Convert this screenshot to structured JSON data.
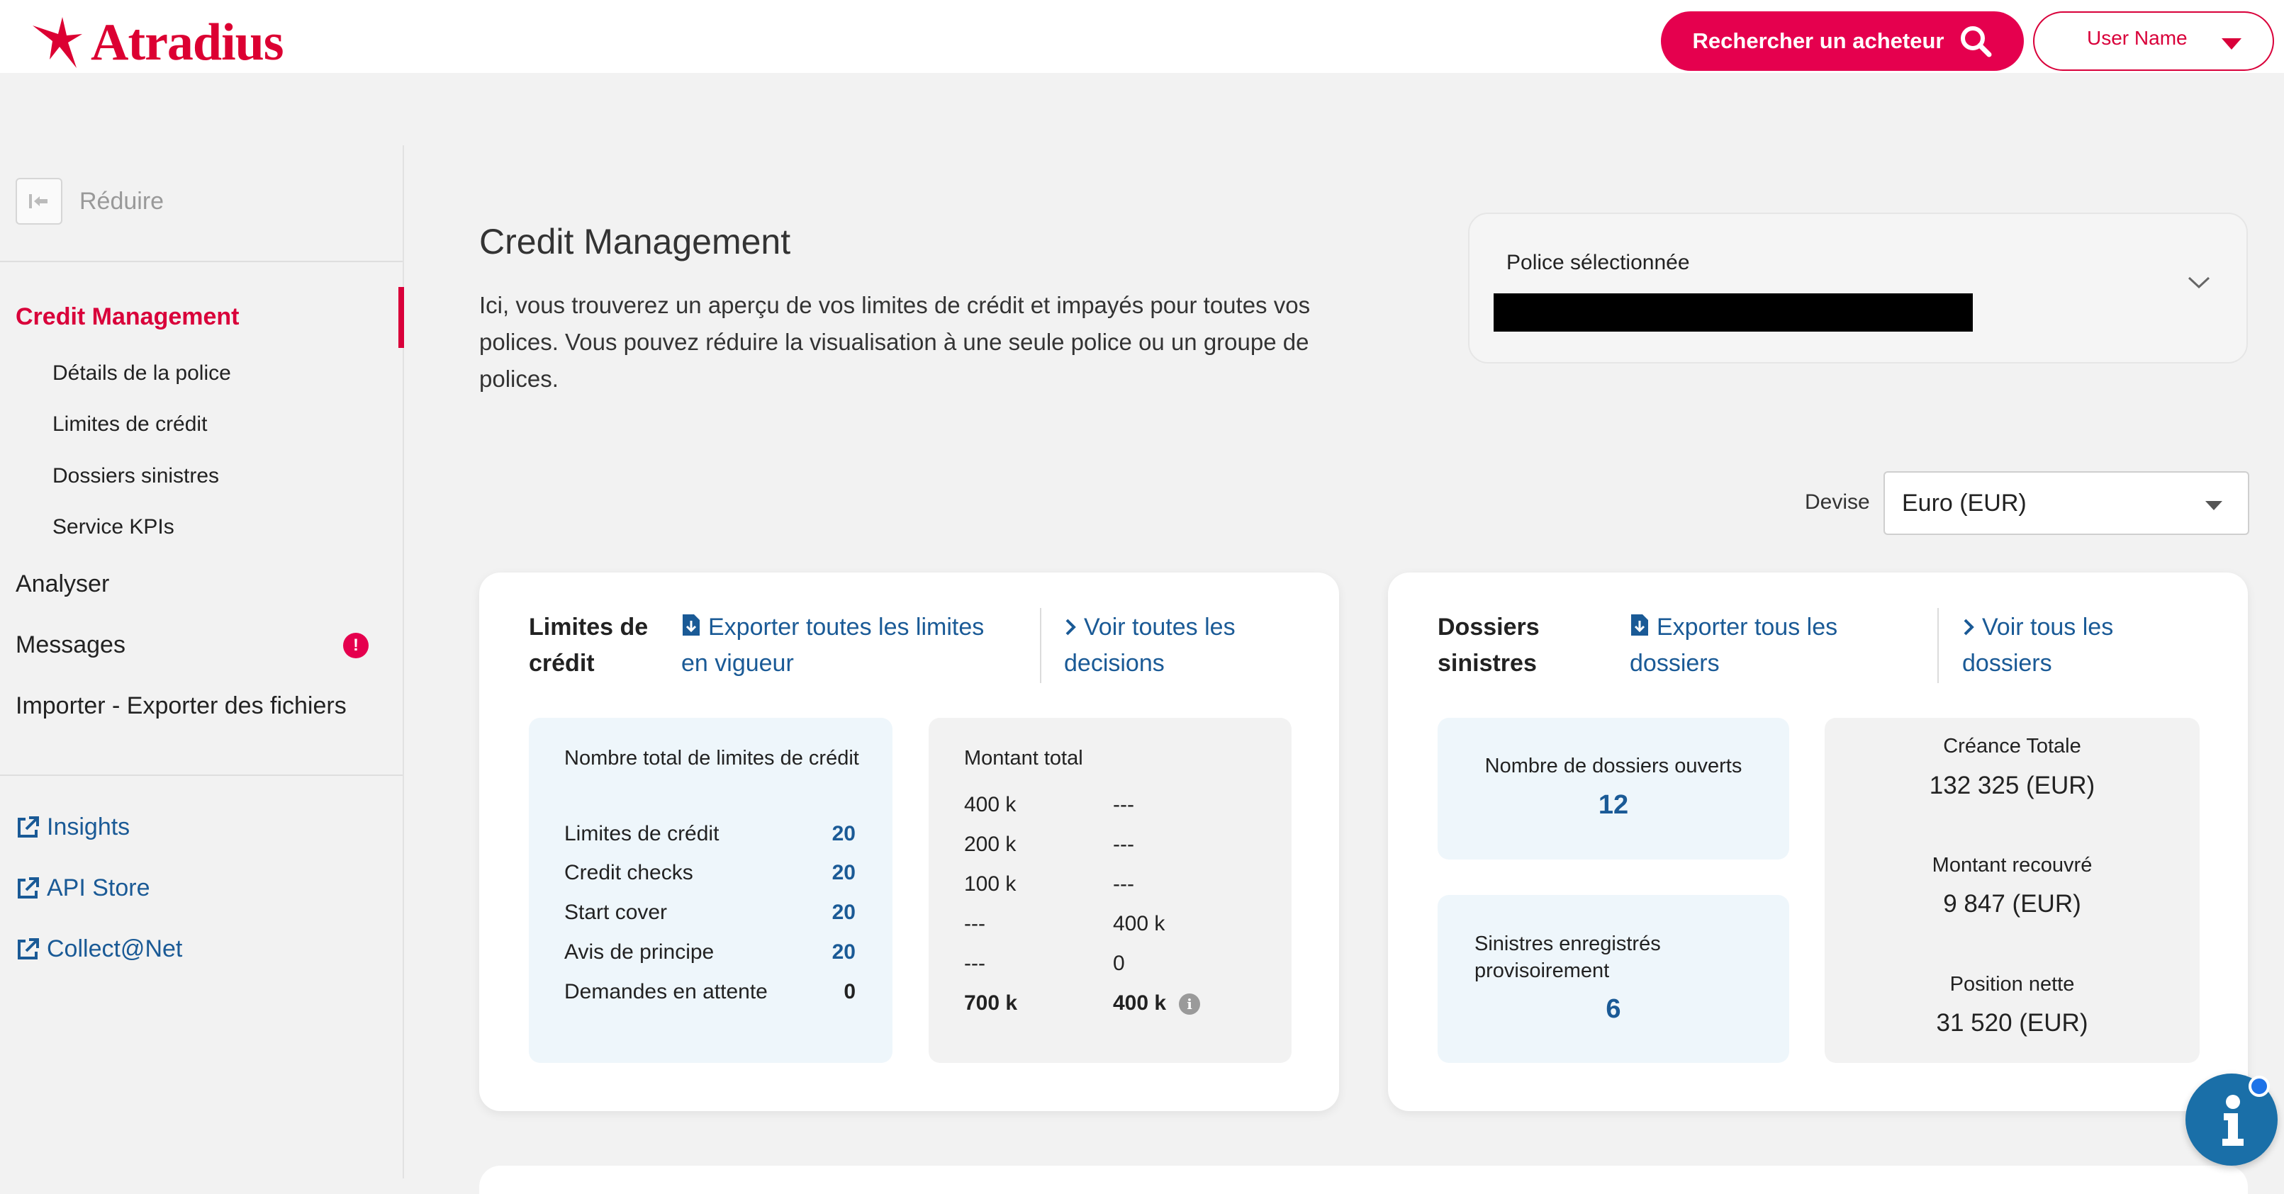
{
  "header": {
    "logo_text": "Atradius",
    "search_label": "Rechercher un acheteur",
    "user_name": "User Name"
  },
  "sidebar": {
    "collapse_label": "Réduire",
    "active_section": "Credit Management",
    "sub_items": [
      {
        "label": "Détails de la police"
      },
      {
        "label": "Limites de crédit"
      },
      {
        "label": "Dossiers sinistres"
      },
      {
        "label": "Service KPIs"
      }
    ],
    "items": [
      {
        "label": "Analyser"
      },
      {
        "label": "Messages",
        "badge": "!"
      },
      {
        "label": "Importer - Exporter des fichiers"
      }
    ],
    "external_links": [
      {
        "label": "Insights"
      },
      {
        "label": "API Store"
      },
      {
        "label": "Collect@Net"
      }
    ]
  },
  "main": {
    "title": "Credit Management",
    "description": "Ici, vous trouverez un aperçu de vos limites de crédit et impayés pour toutes vos polices. Vous pouvez réduire la visualisation à une seule police ou un groupe de polices.",
    "policy": {
      "label": "Police sélectionnée"
    },
    "currency": {
      "label": "Devise",
      "value": "Euro (EUR)"
    }
  },
  "limits_card": {
    "title_line1": "Limites de",
    "title_line2": "crédit",
    "export_line1": "Exporter toutes les limites",
    "export_line2": "en vigueur",
    "view_line1": "Voir toutes les",
    "view_line2": "decisions",
    "totals": {
      "title": "Nombre total de limites de crédit",
      "rows": [
        {
          "label": "Limites de crédit",
          "value": "20"
        },
        {
          "label": "Credit checks",
          "value": "20"
        },
        {
          "label": "Start cover",
          "value": "20"
        },
        {
          "label": "Avis de principe",
          "value": "20"
        },
        {
          "label": "Demandes en attente",
          "value": "0"
        }
      ]
    },
    "amounts": {
      "title": "Montant total",
      "rows": [
        {
          "a": "400 k",
          "b": "---"
        },
        {
          "a": "200 k",
          "b": "---"
        },
        {
          "a": "100 k",
          "b": "---"
        },
        {
          "a": "---",
          "b": "400 k"
        },
        {
          "a": "---",
          "b": "0"
        },
        {
          "a": "700 k",
          "b": "400 k"
        }
      ]
    }
  },
  "claims_card": {
    "title_line1": "Dossiers",
    "title_line2": "sinistres",
    "export_line1": "Exporter tous les",
    "export_line2": "dossiers",
    "view_line1": "Voir tous les",
    "view_line2": "dossiers",
    "open": {
      "label": "Nombre de dossiers ouverts",
      "value": "12"
    },
    "provisional": {
      "label": "Sinistres enregistrés provisoirement",
      "value": "6"
    },
    "summary": [
      {
        "label": "Créance Totale",
        "value": "132 325 (EUR)"
      },
      {
        "label": "Montant recouvré",
        "value": "9 847 (EUR)"
      },
      {
        "label": "Position nette",
        "value": "31 520 (EUR)"
      }
    ]
  },
  "colors": {
    "brand_red": "#dc0032",
    "link_blue": "#1a5a96",
    "panel_blue": "#eef6fb"
  },
  "icons": [
    "search-icon",
    "chevron-down-icon",
    "collapse-icon",
    "alert-icon",
    "external-link-icon",
    "download-file-icon",
    "chevron-right-icon",
    "info-icon"
  ]
}
